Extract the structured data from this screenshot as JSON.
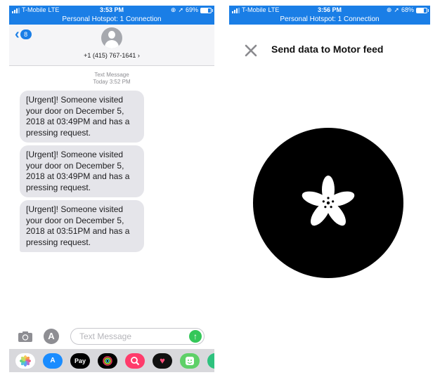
{
  "left_screen": {
    "status": {
      "carrier": "T-Mobile",
      "network": "LTE",
      "time": "3:53 PM",
      "battery": "69%",
      "battery_level": 0.69,
      "hotspot": "Personal Hotspot: 1 Connection"
    },
    "header": {
      "back_badge": "8",
      "contact": "+1 (415) 767-1641 ›"
    },
    "thread_meta": {
      "label": "Text Message",
      "timestamp": "Today 3:52 PM"
    },
    "messages": [
      "[Urgent]! Someone visited your door on December 5, 2018 at 03:49PM and has a pressing request.",
      "[Urgent]! Someone visited your door on December 5, 2018 at 03:49PM and has a pressing request.",
      "[Urgent]! Someone visited your door on December 5, 2018 at 03:51PM and has a pressing request."
    ],
    "input": {
      "placeholder": "Text Message",
      "value": ""
    },
    "app_drawer": [
      {
        "name": "photos-app-icon",
        "label": "",
        "color": "#ffffff"
      },
      {
        "name": "app-store-icon",
        "label": "",
        "color": "#1a8cff"
      },
      {
        "name": "apple-pay-icon",
        "label": "Pay",
        "color": "#000000"
      },
      {
        "name": "activity-icon",
        "label": "",
        "color": "#000000"
      },
      {
        "name": "image-search-icon",
        "label": "",
        "color": "#ff3b6b"
      },
      {
        "name": "heart-app-icon",
        "label": "",
        "color": "#111111"
      },
      {
        "name": "sticker-app-icon",
        "label": "",
        "color": "#5fd068"
      },
      {
        "name": "green-app-icon",
        "label": "",
        "color": "#2ec27e"
      }
    ]
  },
  "right_screen": {
    "status": {
      "carrier": "T-Mobile",
      "network": "LTE",
      "time": "3:56 PM",
      "battery": "68%",
      "battery_level": 0.68,
      "hotspot": "Personal Hotspot: 1 Connection"
    },
    "title": "Send data to Motor feed"
  },
  "colors": {
    "status_bar": "#1a7ee6",
    "bubble": "#e5e5ea",
    "send": "#34c759"
  }
}
